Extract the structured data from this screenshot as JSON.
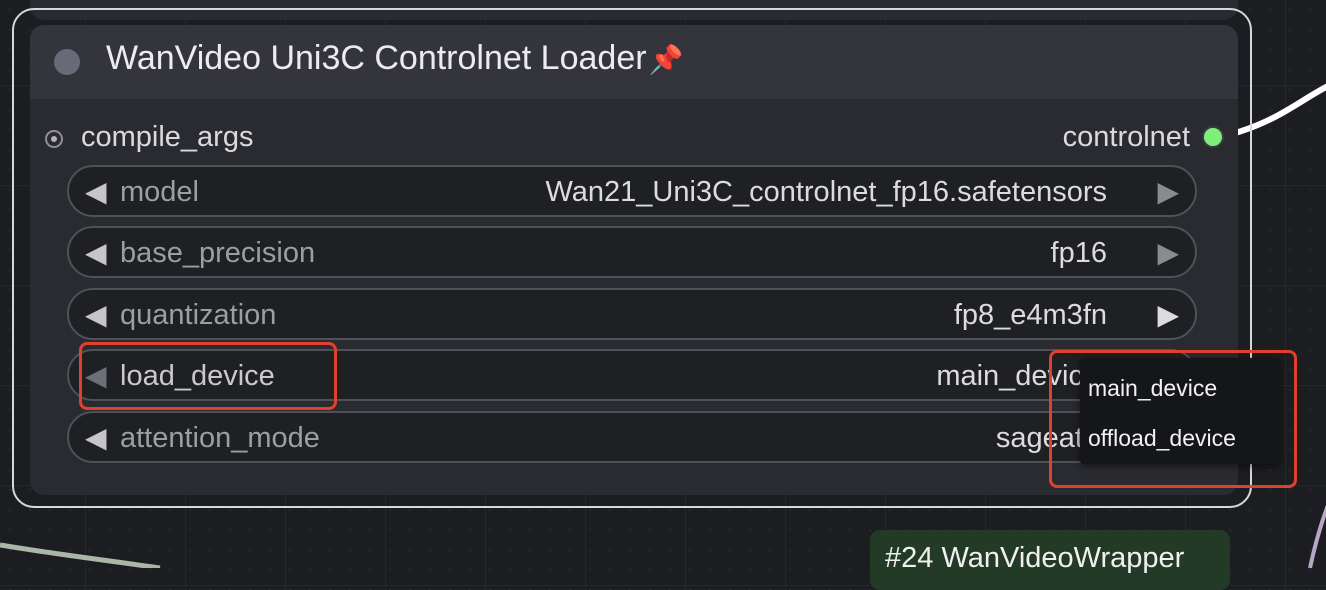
{
  "node": {
    "title": "WanVideo Uni3C Controlnet Loader",
    "pin_icon": "📌",
    "inputs": [
      {
        "label": "compile_args"
      }
    ],
    "outputs": [
      {
        "label": "controlnet",
        "color": "#7ef07a"
      }
    ],
    "widgets": [
      {
        "label": "model",
        "value": "Wan21_Uni3C_controlnet_fp16.safetensors"
      },
      {
        "label": "base_precision",
        "value": "fp16"
      },
      {
        "label": "quantization",
        "value": "fp8_e4m3fn"
      },
      {
        "label": "load_device",
        "value": "main_devic"
      },
      {
        "label": "attention_mode",
        "value": "sageat"
      }
    ]
  },
  "dropdown": {
    "options": [
      "main_device",
      "offload_device"
    ]
  },
  "badge": {
    "text": "#24 WanVideoWrapper"
  },
  "colors": {
    "highlight": "#e0402e",
    "wire": "#ffffff",
    "badge_bg": "#233a26"
  }
}
